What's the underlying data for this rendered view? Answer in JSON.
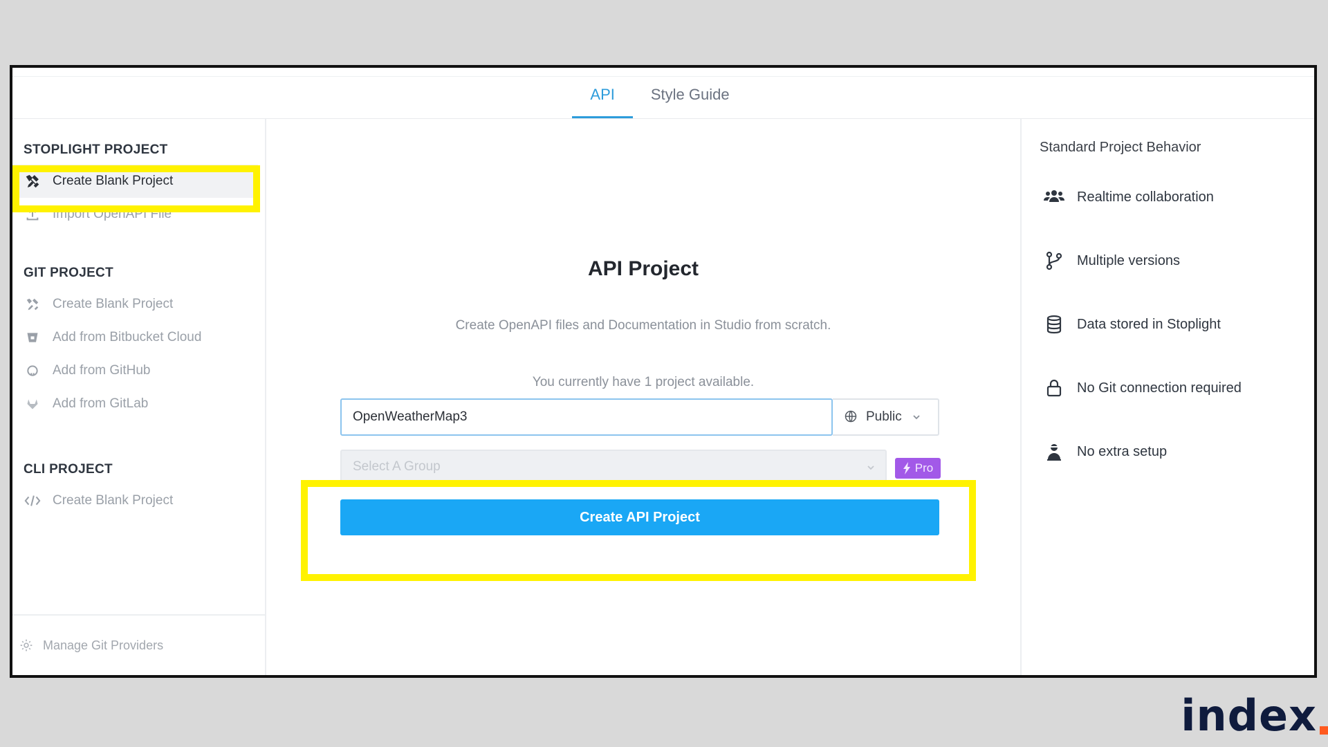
{
  "tabs": [
    {
      "label": "API",
      "active": true
    },
    {
      "label": "Style Guide",
      "active": false
    }
  ],
  "sidebar": {
    "sections": [
      {
        "title": "STOPLIGHT PROJECT",
        "items": [
          {
            "label": "Create Blank Project",
            "icon": "tools-icon",
            "selected": true
          },
          {
            "label": "Import OpenAPI File",
            "icon": "upload-icon",
            "selected": false
          }
        ]
      },
      {
        "title": "GIT PROJECT",
        "items": [
          {
            "label": "Create Blank Project",
            "icon": "tools-icon"
          },
          {
            "label": "Add from Bitbucket Cloud",
            "icon": "bitbucket-icon"
          },
          {
            "label": "Add from GitHub",
            "icon": "github-icon"
          },
          {
            "label": "Add from GitLab",
            "icon": "gitlab-icon"
          }
        ]
      },
      {
        "title": "CLI PROJECT",
        "items": [
          {
            "label": "Create Blank Project",
            "icon": "code-icon"
          }
        ]
      }
    ],
    "footer": {
      "label": "Manage Git Providers",
      "icon": "gear-icon"
    }
  },
  "main": {
    "title": "API Project",
    "description": "Create OpenAPI files and Documentation in Studio from scratch.",
    "availability": "You currently have 1 project available.",
    "name_value": "OpenWeatherMap3",
    "visibility": "Public",
    "group_placeholder": "Select A Group",
    "pro_label": "Pro",
    "create_label": "Create API Project"
  },
  "right": {
    "title": "Standard Project Behavior",
    "features": [
      {
        "label": "Realtime collaboration",
        "icon": "users-icon"
      },
      {
        "label": "Multiple versions",
        "icon": "branch-icon"
      },
      {
        "label": "Data stored in Stoplight",
        "icon": "database-icon"
      },
      {
        "label": "No Git connection required",
        "icon": "lock-icon"
      },
      {
        "label": "No extra setup",
        "icon": "person-icon"
      }
    ]
  },
  "brand": {
    "text": "index",
    "dot_color": "#ff5a1f"
  },
  "colors": {
    "accent": "#1aa7f5",
    "highlight": "#fff200",
    "pro": "#a259e8"
  }
}
